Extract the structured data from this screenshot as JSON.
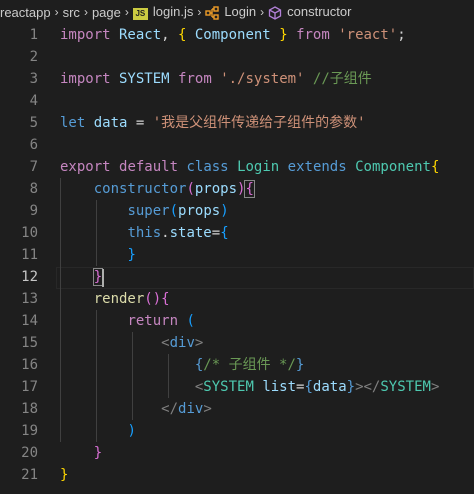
{
  "breadcrumb": {
    "segments": [
      {
        "label": "reactapp",
        "icon": null
      },
      {
        "label": "src",
        "icon": null
      },
      {
        "label": "page",
        "icon": null
      },
      {
        "label": "login.js",
        "icon": "js-file-icon",
        "badge": "JS"
      },
      {
        "label": "Login",
        "icon": "class-symbol-icon"
      },
      {
        "label": "constructor",
        "icon": "method-symbol-icon"
      }
    ],
    "separator": "›"
  },
  "editor": {
    "active_line": 12,
    "lines": [
      {
        "n": "1",
        "tokens": [
          [
            "import",
            "kw-ctrl"
          ],
          [
            " React",
            "var"
          ],
          [
            ", ",
            ""
          ],
          [
            "{",
            "br1"
          ],
          [
            " Component",
            "var"
          ],
          [
            " ",
            ""
          ],
          [
            "}",
            "br1"
          ],
          [
            " ",
            ""
          ],
          [
            "from",
            "kw-ctrl"
          ],
          [
            " ",
            ""
          ],
          [
            "'react'",
            "str"
          ],
          [
            ";",
            ""
          ]
        ]
      },
      {
        "n": "2",
        "tokens": []
      },
      {
        "n": "3",
        "tokens": [
          [
            "import",
            "kw-ctrl"
          ],
          [
            " SYSTEM",
            "var"
          ],
          [
            " ",
            ""
          ],
          [
            "from",
            "kw-ctrl"
          ],
          [
            " ",
            ""
          ],
          [
            "'./system'",
            "str"
          ],
          [
            " ",
            ""
          ],
          [
            "//子组件",
            "cmt"
          ]
        ]
      },
      {
        "n": "4",
        "tokens": []
      },
      {
        "n": "5",
        "tokens": [
          [
            "let",
            "kw"
          ],
          [
            " data",
            "var"
          ],
          [
            " = ",
            ""
          ],
          [
            "'我是父组件传递给子组件的参数'",
            "str"
          ]
        ]
      },
      {
        "n": "6",
        "tokens": []
      },
      {
        "n": "7",
        "tokens": [
          [
            "export",
            "kw-ctrl"
          ],
          [
            " ",
            ""
          ],
          [
            "default",
            "kw-ctrl"
          ],
          [
            " ",
            ""
          ],
          [
            "class",
            "kw"
          ],
          [
            " ",
            ""
          ],
          [
            "Login",
            "cls"
          ],
          [
            " ",
            ""
          ],
          [
            "extends",
            "kw"
          ],
          [
            " ",
            ""
          ],
          [
            "Component",
            "cls"
          ],
          [
            "{",
            "br1"
          ]
        ]
      },
      {
        "n": "8",
        "tokens": [
          [
            "    ",
            ""
          ],
          [
            "constructor",
            "kw"
          ],
          [
            "(",
            "br2"
          ],
          [
            "props",
            "var"
          ],
          [
            ")",
            "br2"
          ],
          [
            "{",
            "br2 bm"
          ]
        ]
      },
      {
        "n": "9",
        "tokens": [
          [
            "        ",
            ""
          ],
          [
            "super",
            "kw"
          ],
          [
            "(",
            "br3"
          ],
          [
            "props",
            "var"
          ],
          [
            ")",
            "br3"
          ]
        ]
      },
      {
        "n": "10",
        "tokens": [
          [
            "        ",
            ""
          ],
          [
            "this",
            "kw"
          ],
          [
            ".",
            ""
          ],
          [
            "state",
            "var"
          ],
          [
            "=",
            ""
          ],
          [
            "{",
            "br3"
          ]
        ]
      },
      {
        "n": "11",
        "tokens": [
          [
            "        ",
            ""
          ],
          [
            "}",
            "br3"
          ]
        ]
      },
      {
        "n": "12",
        "tokens": [
          [
            "    ",
            ""
          ],
          [
            "}",
            "br2 bm"
          ]
        ]
      },
      {
        "n": "13",
        "tokens": [
          [
            "    ",
            ""
          ],
          [
            "render",
            "fn"
          ],
          [
            "(",
            "br2"
          ],
          [
            ")",
            "br2"
          ],
          [
            "{",
            "br2"
          ]
        ]
      },
      {
        "n": "14",
        "tokens": [
          [
            "        ",
            ""
          ],
          [
            "return",
            "kw-ctrl"
          ],
          [
            " ",
            ""
          ],
          [
            "(",
            "br3"
          ]
        ]
      },
      {
        "n": "15",
        "tokens": [
          [
            "            ",
            ""
          ],
          [
            "<",
            "punc"
          ],
          [
            "div",
            "tag"
          ],
          [
            ">",
            "punc"
          ]
        ]
      },
      {
        "n": "16",
        "tokens": [
          [
            "                ",
            ""
          ],
          [
            "{",
            "kw"
          ],
          [
            "/* 子组件 */",
            "cmt"
          ],
          [
            "}",
            "kw"
          ]
        ]
      },
      {
        "n": "17",
        "tokens": [
          [
            "                ",
            ""
          ],
          [
            "<",
            "punc"
          ],
          [
            "SYSTEM",
            "cls"
          ],
          [
            " ",
            ""
          ],
          [
            "list",
            "var"
          ],
          [
            "=",
            ""
          ],
          [
            "{",
            "kw"
          ],
          [
            "data",
            "var"
          ],
          [
            "}",
            "kw"
          ],
          [
            "></",
            "punc"
          ],
          [
            "SYSTEM",
            "cls"
          ],
          [
            ">",
            "punc"
          ]
        ]
      },
      {
        "n": "18",
        "tokens": [
          [
            "            ",
            ""
          ],
          [
            "</",
            "punc"
          ],
          [
            "div",
            "tag"
          ],
          [
            ">",
            "punc"
          ]
        ]
      },
      {
        "n": "19",
        "tokens": [
          [
            "        ",
            ""
          ],
          [
            ")",
            "br3"
          ]
        ]
      },
      {
        "n": "20",
        "tokens": [
          [
            "    ",
            ""
          ],
          [
            "}",
            "br2"
          ]
        ]
      },
      {
        "n": "21",
        "tokens": [
          [
            "}",
            "br1"
          ]
        ]
      }
    ]
  }
}
